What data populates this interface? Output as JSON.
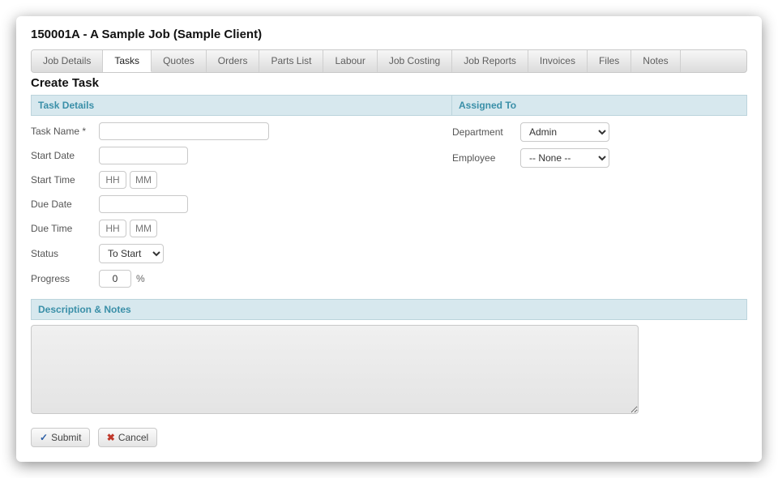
{
  "header": {
    "title": "150001A - A Sample Job (Sample Client)"
  },
  "tabs": {
    "items": [
      {
        "label": "Job Details"
      },
      {
        "label": "Tasks"
      },
      {
        "label": "Quotes"
      },
      {
        "label": "Orders"
      },
      {
        "label": "Parts List"
      },
      {
        "label": "Labour"
      },
      {
        "label": "Job Costing"
      },
      {
        "label": "Job Reports"
      },
      {
        "label": "Invoices"
      },
      {
        "label": "Files"
      },
      {
        "label": "Notes"
      }
    ],
    "active_index": 1
  },
  "section": {
    "title": "Create Task"
  },
  "task_details": {
    "header": "Task Details",
    "labels": {
      "task_name": "Task Name *",
      "start_date": "Start Date",
      "start_time": "Start Time",
      "due_date": "Due Date",
      "due_time": "Due Time",
      "status": "Status",
      "progress": "Progress"
    },
    "placeholders": {
      "hh": "HH",
      "mm": "MM"
    },
    "values": {
      "task_name": "",
      "start_date": "",
      "start_hh": "",
      "start_mm": "",
      "due_date": "",
      "due_hh": "",
      "due_mm": "",
      "status_selected": "To Start",
      "progress": "0"
    },
    "progress_unit": "%"
  },
  "assigned_to": {
    "header": "Assigned To",
    "labels": {
      "department": "Department",
      "employee": "Employee"
    },
    "values": {
      "department_selected": "Admin",
      "employee_selected": "-- None --"
    }
  },
  "desc_notes": {
    "header": "Description & Notes",
    "value": ""
  },
  "buttons": {
    "submit": "Submit",
    "cancel": "Cancel"
  }
}
